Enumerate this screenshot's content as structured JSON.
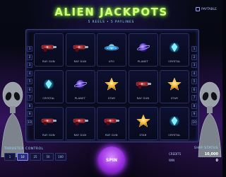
{
  "header": {
    "title": "ALIEN JACKPOTS",
    "subtitle": "5 REELS • 5 PAYLINES",
    "paytable_label": "PAYTABLE"
  },
  "paylines_left": [
    "1",
    "2",
    "3",
    "4",
    "5",
    "6",
    "7",
    "8",
    "9",
    "10"
  ],
  "paylines_right": [
    "1",
    "2",
    "3",
    "4",
    "5",
    "6",
    "7",
    "8",
    "9",
    "10"
  ],
  "reels": {
    "row1": [
      "RAY GUN",
      "RAY GUN",
      "UFO",
      "PLANET",
      "CRYSTAL"
    ],
    "row2": [
      "CRYSTAL",
      "PLANET",
      "STAR",
      "RAY GUN",
      "STAR"
    ],
    "row3": [
      "RAY GUN",
      "RAY GUN",
      "RAY GUN",
      "STAR",
      "CRYSTAL"
    ]
  },
  "controls": {
    "thrust_label": "THRUSTER CONTROL",
    "bets": [
      "1",
      "10",
      "25",
      "50",
      "100"
    ],
    "spin_label": "SPIN"
  },
  "ship_status": {
    "header": "SHIP STATUS",
    "row1_label": "CREDITS",
    "row1_value": "10,000",
    "row2_label": "WIN",
    "row2_value": "0"
  },
  "colors": {
    "accent": "#d6ff7a",
    "spin": "#9b2fe0"
  }
}
